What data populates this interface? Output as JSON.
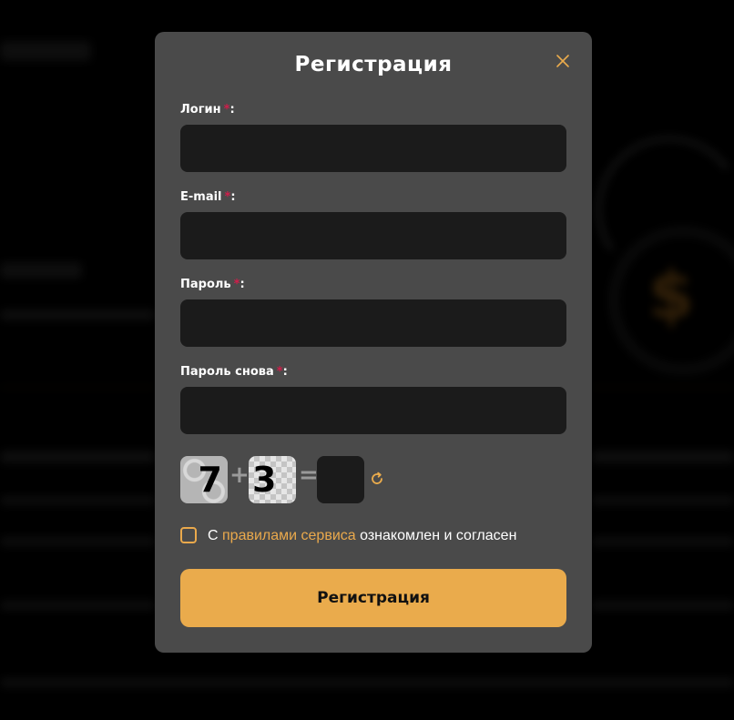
{
  "modal": {
    "title": "Регистрация",
    "close_icon": "close-icon",
    "required_mark": "*",
    "fields": [
      {
        "label": "Логин",
        "value": "",
        "placeholder": ""
      },
      {
        "label": "E-mail",
        "value": "",
        "placeholder": ""
      },
      {
        "label": "Пароль",
        "value": "",
        "placeholder": ""
      },
      {
        "label": "Пароль снова",
        "value": "",
        "placeholder": ""
      }
    ],
    "captcha": {
      "first_digit": "7",
      "operator": "+",
      "second_digit": "3",
      "equals": "=",
      "answer": "",
      "refresh_icon": "refresh-icon"
    },
    "agreement": {
      "prefix": "С ",
      "link": "правилами сервиса",
      "suffix": " ознакомлен и согласен",
      "checked": false
    },
    "submit_label": "Регистрация"
  },
  "colors": {
    "accent": "#eaab4c",
    "required": "#d11d4a",
    "modal_bg": "#4a4a4a",
    "input_bg": "#1b1b1b"
  }
}
